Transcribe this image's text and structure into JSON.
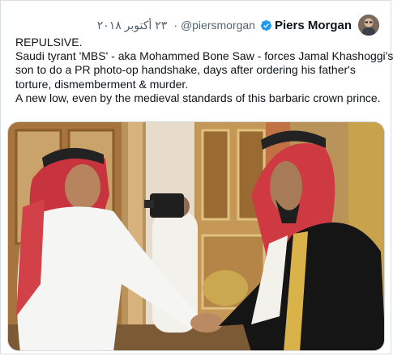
{
  "tweet": {
    "author": {
      "display_name": "Piers Morgan",
      "handle": "@piersmorgan",
      "verified": true,
      "avatar_icon": "avatar-photo-icon",
      "verified_icon": "verified-badge-icon"
    },
    "separator": "·",
    "date": "٢٣ أكتوبر ٢٠١٨",
    "text_lines": [
      "REPULSIVE.",
      "Saudi tyrant 'MBS' - aka Mohammed Bone Saw - forces Jamal Khashoggi's",
      "son to do a PR photo-op handshake, days after ordering his father's",
      "torture, dismemberment & murder.",
      "A new low, even by the medieval standards of this barbaric crown prince."
    ]
  },
  "colors": {
    "verified_badge": "#1d9bf0",
    "text_primary": "#0f1419",
    "text_secondary": "#536471",
    "border": "#d8dee3"
  }
}
